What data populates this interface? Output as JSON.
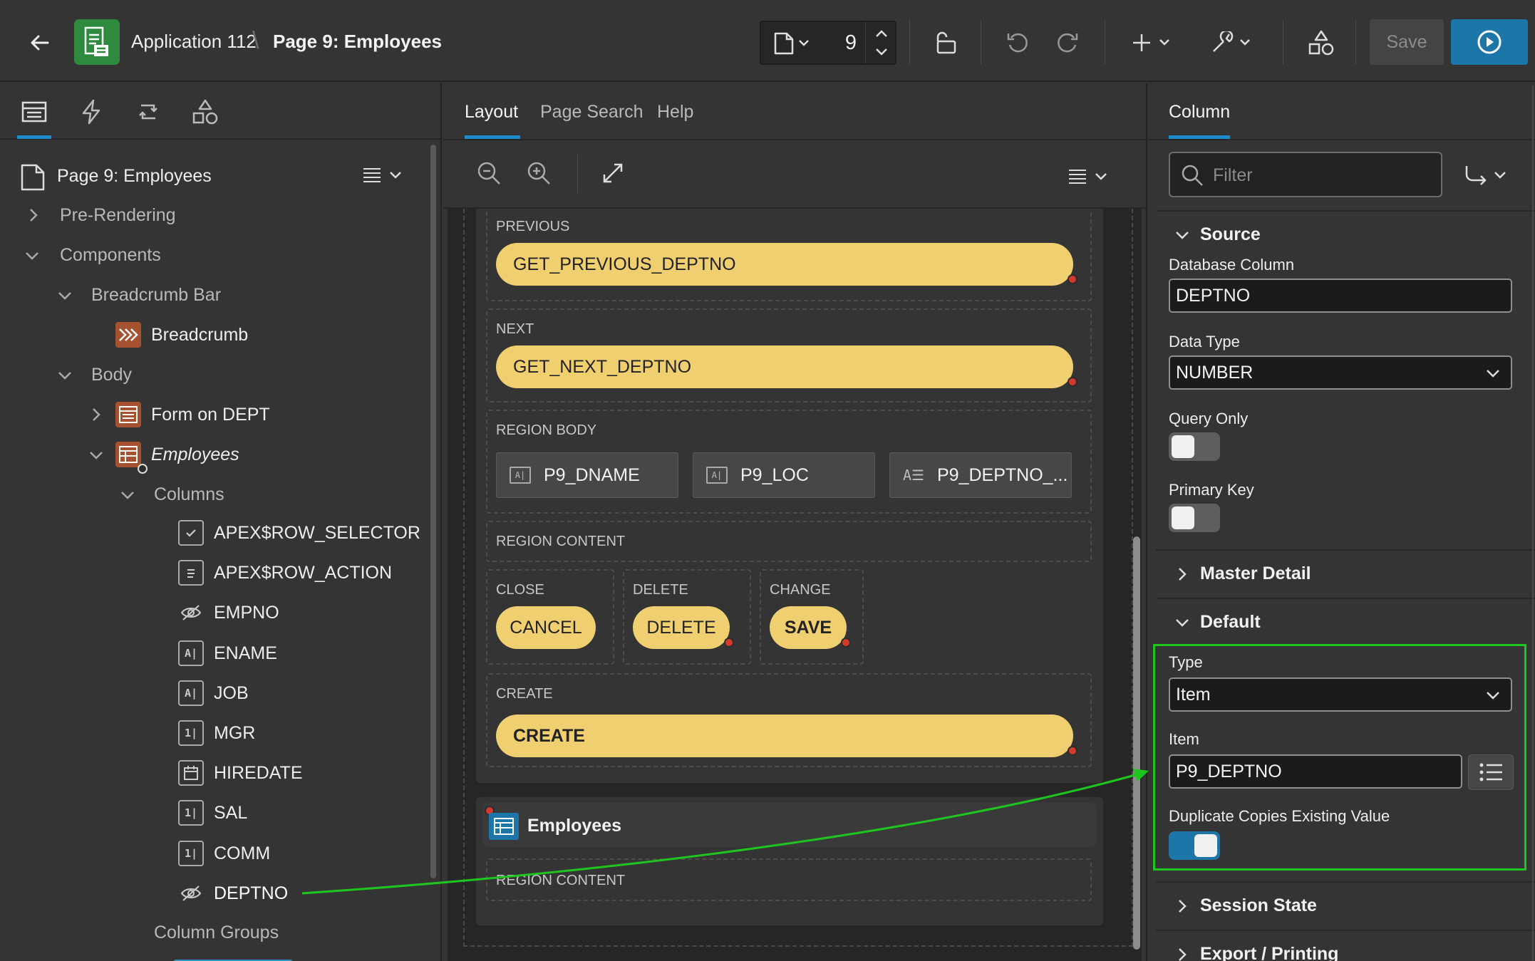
{
  "header": {
    "app_name": "Application 112",
    "page_name": "Page 9: Employees",
    "page_number": "9",
    "save_label": "Save",
    "icons": [
      "back-arrow-icon",
      "app-logo-icon",
      "page-icon",
      "lock-icon",
      "undo-icon",
      "redo-icon",
      "plus-icon",
      "wrench-icon",
      "shared-components-icon",
      "run-icon"
    ]
  },
  "left": {
    "root": "Page 9: Employees",
    "pre_rendering": "Pre-Rendering",
    "components": "Components",
    "breadcrumb_bar": "Breadcrumb Bar",
    "breadcrumb": "Breadcrumb",
    "body": "Body",
    "form_on_dept": "Form on DEPT",
    "employees": "Employees",
    "columns": "Columns",
    "column_items": [
      {
        "label": "APEX$ROW_SELECTOR",
        "icon": "checkbox-icon"
      },
      {
        "label": "APEX$ROW_ACTION",
        "icon": "clipboard-icon"
      },
      {
        "label": "EMPNO",
        "icon": "hidden-eye-icon"
      },
      {
        "label": "ENAME",
        "icon": "text-field-icon"
      },
      {
        "label": "JOB",
        "icon": "text-field-icon"
      },
      {
        "label": "MGR",
        "icon": "number-field-icon"
      },
      {
        "label": "HIREDATE",
        "icon": "calendar-icon"
      },
      {
        "label": "SAL",
        "icon": "number-field-icon"
      },
      {
        "label": "COMM",
        "icon": "number-field-icon"
      },
      {
        "label": "DEPTNO",
        "icon": "hidden-eye-icon",
        "selected": true
      }
    ],
    "column_groups": "Column Groups"
  },
  "center": {
    "tabs": [
      "Layout",
      "Page Search",
      "Help"
    ],
    "active_tab": "Layout",
    "previous_label": "PREVIOUS",
    "previous_button": "GET_PREVIOUS_DEPTNO",
    "next_label": "NEXT",
    "next_button": "GET_NEXT_DEPTNO",
    "region_body_label": "REGION BODY",
    "items": [
      "P9_DNAME",
      "P9_LOC",
      "P9_DEPTNO_..."
    ],
    "region_content_label": "REGION CONTENT",
    "close_label": "CLOSE",
    "cancel_button": "CANCEL",
    "delete_label": "DELETE",
    "delete_button": "DELETE",
    "change_label": "CHANGE",
    "save_button": "SAVE",
    "create_label": "CREATE",
    "create_button": "CREATE",
    "employees_region": "Employees",
    "emp_region_content_label": "REGION CONTENT"
  },
  "right": {
    "tab": "Column",
    "filter_placeholder": "Filter",
    "source_title": "Source",
    "database_column_label": "Database Column",
    "database_column_value": "DEPTNO",
    "data_type_label": "Data Type",
    "data_type_value": "NUMBER",
    "query_only_label": "Query Only",
    "query_only": false,
    "primary_key_label": "Primary Key",
    "primary_key": false,
    "master_detail_title": "Master Detail",
    "default_title": "Default",
    "type_label": "Type",
    "type_value": "Item",
    "item_label": "Item",
    "item_value": "P9_DEPTNO",
    "duplicate_label": "Duplicate Copies Existing Value",
    "duplicate_copies": true,
    "session_state_title": "Session State",
    "export_printing_title": "Export / Printing"
  },
  "colors": {
    "accent": "#1d76a8",
    "button_yellow": "#f0cf70",
    "annotation_green": "#1fc51f",
    "app_logo_green": "#2e8b3d",
    "component_orange": "#a55230"
  }
}
